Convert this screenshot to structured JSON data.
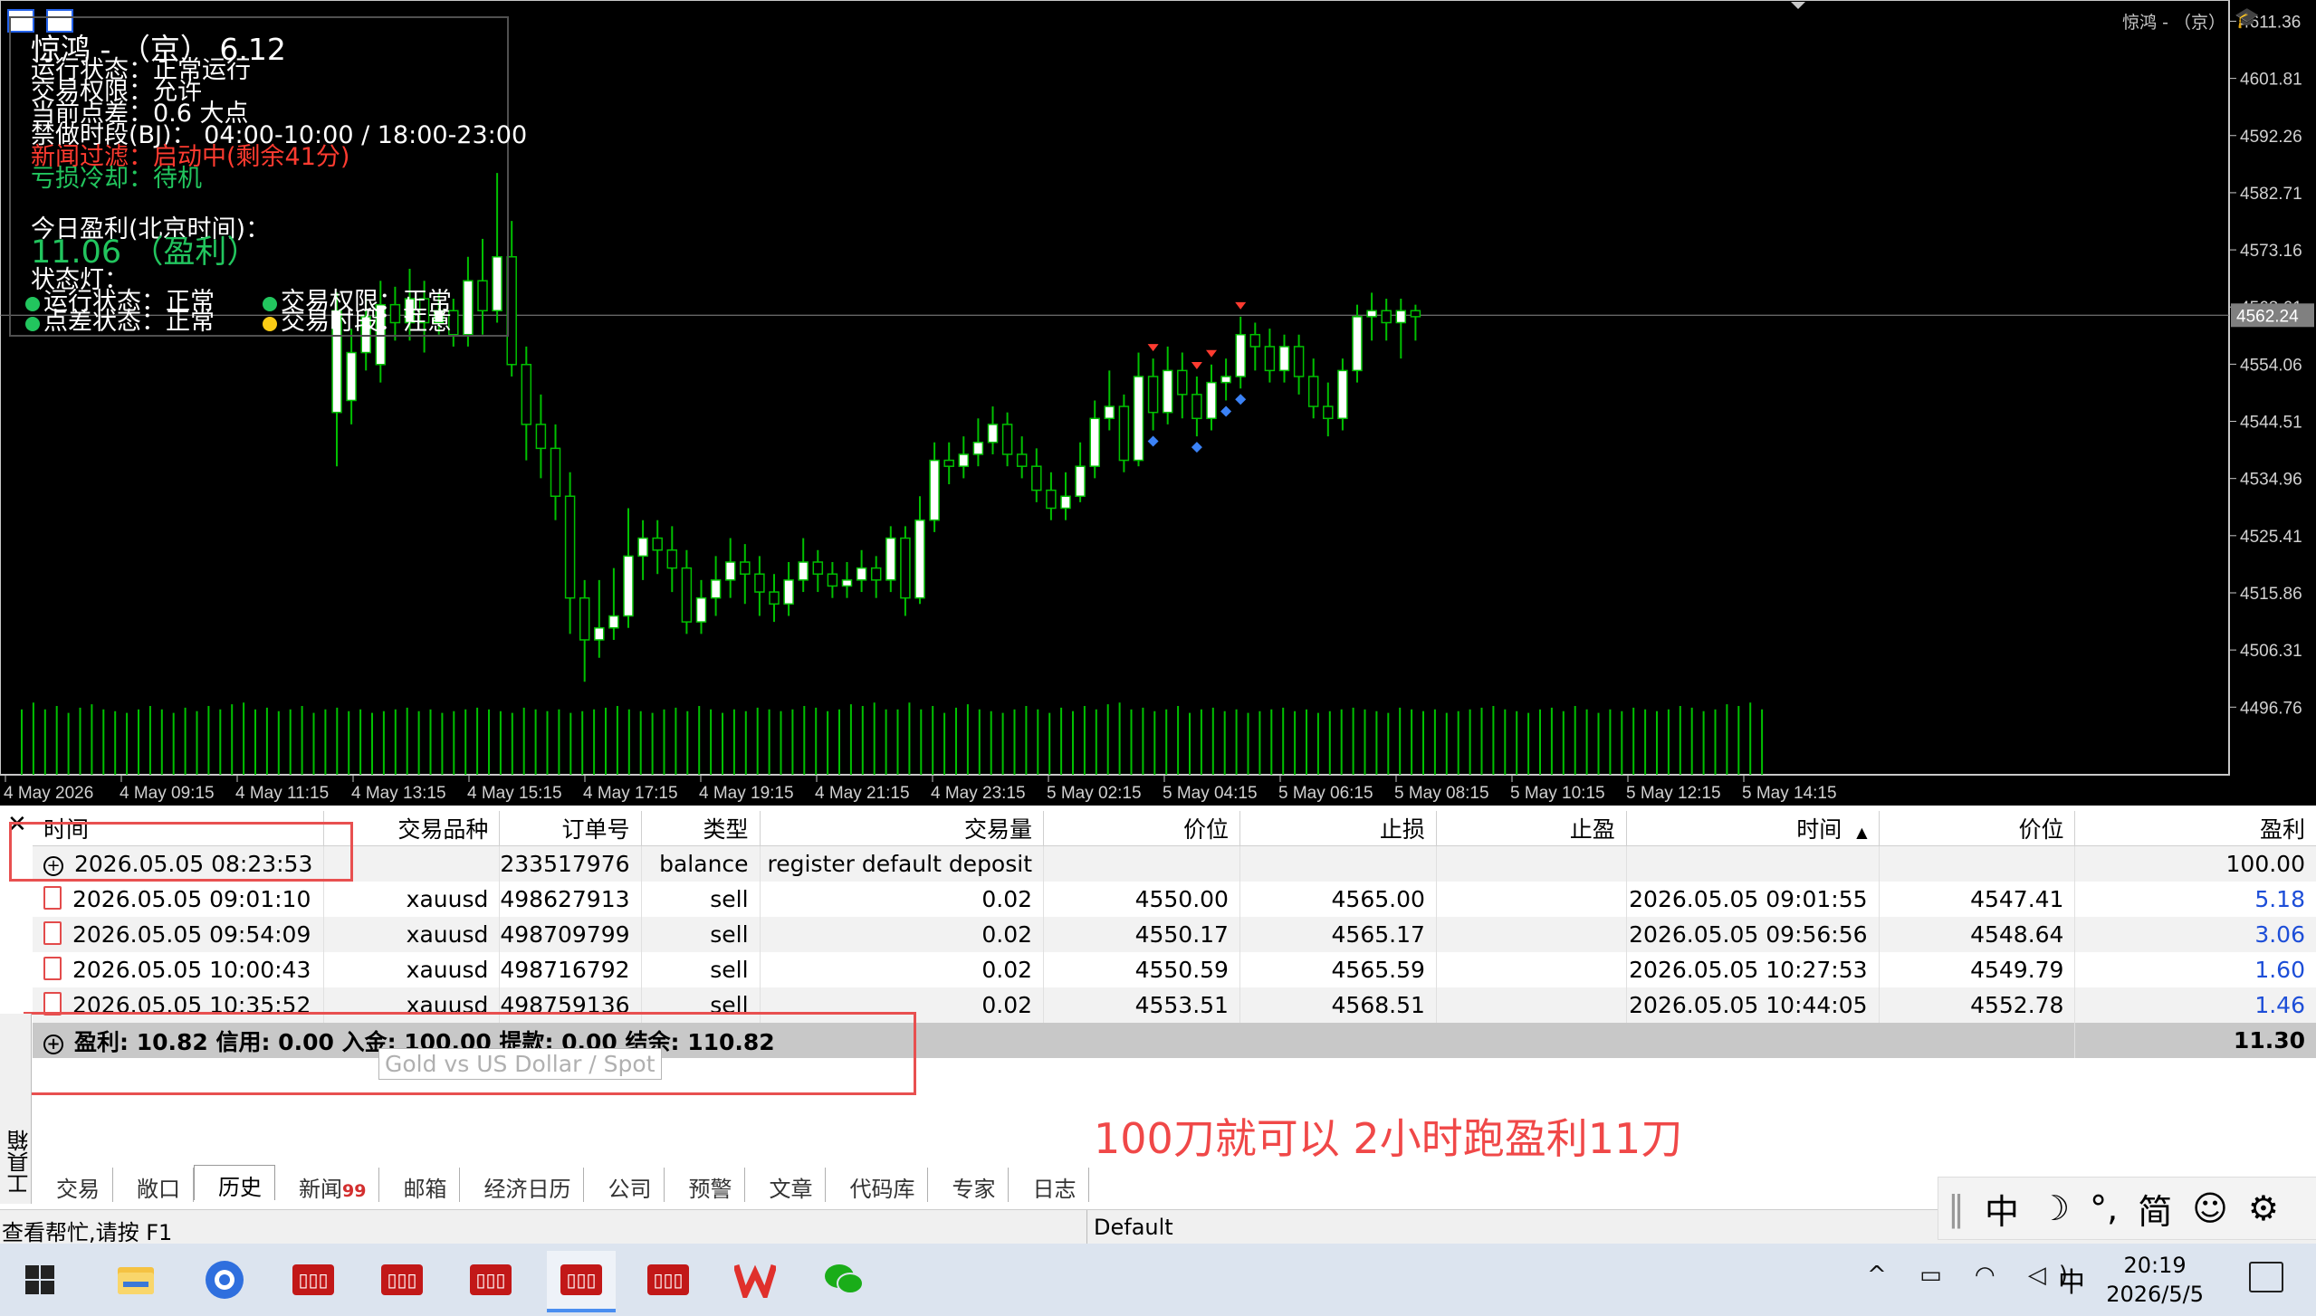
{
  "chart": {
    "symbol_title": "惊鸿 - （京）",
    "overlay": {
      "title": "惊鸿 - （京）",
      "version": "6.12",
      "run_status": "运行状态：正常运行",
      "trade_perm": "交易权限：允许",
      "spread": "当前点差：0.6 大点",
      "forbidden": "禁做时段(BJ)： 04:00-10:00 / 18:00-23:00",
      "news_filter": "新闻过滤：启动中(剩余41分)",
      "loss_cooldown": "亏损冷却：待机",
      "today_label": "今日盈利(北京时间)：",
      "today_value": "11.06",
      "today_state": "（盈利）",
      "lights_label": "状态灯：",
      "light1": "运行状态：正常",
      "light2": "交易权限：正常",
      "light3": "点差状态：正常",
      "light4": "交易时段：注意",
      "light_colors": {
        "ok": "#22c55e",
        "warn": "#facc15"
      }
    },
    "current_price": "4562.24"
  },
  "chart_data": {
    "type": "candlestick",
    "y_ticks": [
      "4611.36",
      "4601.81",
      "4592.26",
      "4582.71",
      "4573.16",
      "4563.61",
      "4554.06",
      "4544.51",
      "4534.96",
      "4525.41",
      "4515.86",
      "4506.31",
      "4496.76"
    ],
    "x_ticks": [
      "4 May 2026",
      "4 May 09:15",
      "4 May 11:15",
      "4 May 13:15",
      "4 May 15:15",
      "4 May 17:15",
      "4 May 19:15",
      "4 May 21:15",
      "4 May 23:15",
      "5 May 02:15",
      "5 May 04:15",
      "5 May 06:15",
      "5 May 08:15",
      "5 May 10:15",
      "5 May 12:15",
      "5 May 14:15"
    ],
    "current_price": 4562.24,
    "colors": {
      "up": "#ffffff",
      "down": "#000000",
      "wick": "#00c000",
      "volume": "#00c000",
      "background": "#000000"
    },
    "candles": [
      {
        "o": 4546,
        "c": 4563,
        "h": 4566,
        "l": 4537
      },
      {
        "o": 4548,
        "c": 4556,
        "h": 4560,
        "l": 4544
      },
      {
        "o": 4556,
        "c": 4562,
        "h": 4566,
        "l": 4553
      },
      {
        "o": 4554,
        "c": 4564,
        "h": 4568,
        "l": 4551
      },
      {
        "o": 4564,
        "c": 4561,
        "h": 4567,
        "l": 4558
      },
      {
        "o": 4561,
        "c": 4565,
        "h": 4570,
        "l": 4558
      },
      {
        "o": 4565,
        "c": 4561,
        "h": 4568,
        "l": 4556
      },
      {
        "o": 4561,
        "c": 4563,
        "h": 4566,
        "l": 4559
      },
      {
        "o": 4563,
        "c": 4559,
        "h": 4565,
        "l": 4557
      },
      {
        "o": 4559,
        "c": 4568,
        "h": 4572,
        "l": 4557
      },
      {
        "o": 4568,
        "c": 4563,
        "h": 4575,
        "l": 4559
      },
      {
        "o": 4563,
        "c": 4572,
        "h": 4586,
        "l": 4561
      },
      {
        "o": 4572,
        "c": 4554,
        "h": 4578,
        "l": 4552
      },
      {
        "o": 4554,
        "c": 4544,
        "h": 4557,
        "l": 4538
      },
      {
        "o": 4544,
        "c": 4540,
        "h": 4549,
        "l": 4535
      },
      {
        "o": 4540,
        "c": 4532,
        "h": 4544,
        "l": 4528
      },
      {
        "o": 4532,
        "c": 4515,
        "h": 4536,
        "l": 4509
      },
      {
        "o": 4515,
        "c": 4508,
        "h": 4518,
        "l": 4501
      },
      {
        "o": 4508,
        "c": 4510,
        "h": 4518,
        "l": 4505
      },
      {
        "o": 4510,
        "c": 4512,
        "h": 4520,
        "l": 4508
      },
      {
        "o": 4512,
        "c": 4522,
        "h": 4530,
        "l": 4510
      },
      {
        "o": 4522,
        "c": 4525,
        "h": 4528,
        "l": 4518
      },
      {
        "o": 4525,
        "c": 4523,
        "h": 4528,
        "l": 4519
      },
      {
        "o": 4523,
        "c": 4520,
        "h": 4527,
        "l": 4516
      },
      {
        "o": 4520,
        "c": 4511,
        "h": 4523,
        "l": 4509
      },
      {
        "o": 4511,
        "c": 4515,
        "h": 4518,
        "l": 4509
      },
      {
        "o": 4515,
        "c": 4518,
        "h": 4522,
        "l": 4512
      },
      {
        "o": 4518,
        "c": 4521,
        "h": 4525,
        "l": 4515
      },
      {
        "o": 4521,
        "c": 4519,
        "h": 4524,
        "l": 4514
      },
      {
        "o": 4519,
        "c": 4516,
        "h": 4522,
        "l": 4512
      },
      {
        "o": 4516,
        "c": 4514,
        "h": 4519,
        "l": 4511
      },
      {
        "o": 4514,
        "c": 4518,
        "h": 4521,
        "l": 4512
      },
      {
        "o": 4518,
        "c": 4521,
        "h": 4525,
        "l": 4516
      },
      {
        "o": 4521,
        "c": 4519,
        "h": 4523,
        "l": 4516
      },
      {
        "o": 4519,
        "c": 4517,
        "h": 4521,
        "l": 4515
      },
      {
        "o": 4517,
        "c": 4518,
        "h": 4521,
        "l": 4515
      },
      {
        "o": 4518,
        "c": 4520,
        "h": 4523,
        "l": 4516
      },
      {
        "o": 4520,
        "c": 4518,
        "h": 4522,
        "l": 4515
      },
      {
        "o": 4518,
        "c": 4525,
        "h": 4527,
        "l": 4516
      },
      {
        "o": 4525,
        "c": 4515,
        "h": 4527,
        "l": 4512
      },
      {
        "o": 4515,
        "c": 4528,
        "h": 4532,
        "l": 4514
      },
      {
        "o": 4528,
        "c": 4538,
        "h": 4541,
        "l": 4526
      },
      {
        "o": 4538,
        "c": 4537,
        "h": 4541,
        "l": 4534
      },
      {
        "o": 4537,
        "c": 4539,
        "h": 4542,
        "l": 4535
      },
      {
        "o": 4539,
        "c": 4541,
        "h": 4545,
        "l": 4537
      },
      {
        "o": 4541,
        "c": 4544,
        "h": 4547,
        "l": 4539
      },
      {
        "o": 4544,
        "c": 4539,
        "h": 4546,
        "l": 4537
      },
      {
        "o": 4539,
        "c": 4537,
        "h": 4542,
        "l": 4535
      },
      {
        "o": 4537,
        "c": 4533,
        "h": 4540,
        "l": 4531
      },
      {
        "o": 4533,
        "c": 4530,
        "h": 4536,
        "l": 4528
      },
      {
        "o": 4530,
        "c": 4532,
        "h": 4536,
        "l": 4528
      },
      {
        "o": 4532,
        "c": 4537,
        "h": 4541,
        "l": 4531
      },
      {
        "o": 4537,
        "c": 4545,
        "h": 4548,
        "l": 4535
      },
      {
        "o": 4545,
        "c": 4547,
        "h": 4553,
        "l": 4543
      },
      {
        "o": 4547,
        "c": 4538,
        "h": 4549,
        "l": 4536
      },
      {
        "o": 4538,
        "c": 4552,
        "h": 4556,
        "l": 4537
      },
      {
        "o": 4552,
        "c": 4546,
        "h": 4555,
        "l": 4543
      },
      {
        "o": 4546,
        "c": 4553,
        "h": 4557,
        "l": 4544
      },
      {
        "o": 4553,
        "c": 4549,
        "h": 4556,
        "l": 4545
      },
      {
        "o": 4549,
        "c": 4545,
        "h": 4552,
        "l": 4542
      },
      {
        "o": 4545,
        "c": 4551,
        "h": 4554,
        "l": 4543
      },
      {
        "o": 4551,
        "c": 4552,
        "h": 4555,
        "l": 4548
      },
      {
        "o": 4552,
        "c": 4559,
        "h": 4562,
        "l": 4550
      },
      {
        "o": 4559,
        "c": 4557,
        "h": 4561,
        "l": 4553
      },
      {
        "o": 4557,
        "c": 4553,
        "h": 4560,
        "l": 4551
      },
      {
        "o": 4553,
        "c": 4557,
        "h": 4559,
        "l": 4551
      },
      {
        "o": 4557,
        "c": 4552,
        "h": 4559,
        "l": 4549
      },
      {
        "o": 4552,
        "c": 4547,
        "h": 4555,
        "l": 4545
      },
      {
        "o": 4547,
        "c": 4545,
        "h": 4551,
        "l": 4542
      },
      {
        "o": 4545,
        "c": 4553,
        "h": 4555,
        "l": 4543
      },
      {
        "o": 4553,
        "c": 4562,
        "h": 4564,
        "l": 4551
      },
      {
        "o": 4562,
        "c": 4563,
        "h": 4566,
        "l": 4558
      },
      {
        "o": 4563,
        "c": 4561,
        "h": 4565,
        "l": 4558
      },
      {
        "o": 4561,
        "c": 4563,
        "h": 4565,
        "l": 4555
      },
      {
        "o": 4563,
        "c": 4562,
        "h": 4564,
        "l": 4558
      }
    ],
    "volumes": [
      38,
      42,
      38,
      40,
      36,
      39,
      41,
      38,
      37,
      36,
      38,
      40,
      38,
      36,
      39,
      37,
      40,
      38,
      41,
      42,
      38,
      39,
      37,
      38,
      40,
      36,
      38,
      39,
      37,
      38,
      36,
      37,
      38,
      39,
      37,
      38,
      36,
      37,
      38,
      39,
      38,
      37,
      36,
      39,
      38,
      37,
      38,
      36,
      37,
      38,
      39,
      40,
      38,
      37,
      36,
      38,
      39,
      37,
      40,
      38,
      36,
      38,
      37,
      39,
      38,
      37,
      38,
      40,
      39,
      37,
      38,
      41,
      40,
      42,
      38
    ],
    "trade_markers": [
      {
        "candle": 56,
        "kind": "sell_open"
      },
      {
        "candle": 56,
        "kind": "close"
      },
      {
        "candle": 59,
        "kind": "sell_open"
      },
      {
        "candle": 59,
        "kind": "close"
      },
      {
        "candle": 60,
        "kind": "sell_open"
      },
      {
        "candle": 61,
        "kind": "close"
      },
      {
        "candle": 62,
        "kind": "sell_open"
      },
      {
        "candle": 62,
        "kind": "close"
      }
    ]
  },
  "terminal": {
    "columns": [
      "时间",
      "交易品种",
      "订单号",
      "类型",
      "交易量",
      "价位",
      "止损",
      "止盈",
      "时间",
      "价位",
      "盈利"
    ],
    "sort_arrow": "▲",
    "rows": [
      {
        "time": "2026.05.05 08:23:53",
        "symbol": "",
        "order": "233517976",
        "type": "balance",
        "volume": "register default deposit",
        "price": "",
        "sl": "",
        "tp": "",
        "time2": "",
        "price2": "",
        "profit": "100.00",
        "icon": "plus"
      },
      {
        "time": "2026.05.05 09:01:10",
        "symbol": "xauusd",
        "order": "498627913",
        "type": "sell",
        "volume": "0.02",
        "price": "4550.00",
        "sl": "4565.00",
        "tp": "",
        "time2": "2026.05.05 09:01:55",
        "price2": "4547.41",
        "profit": "5.18",
        "icon": "doc"
      },
      {
        "time": "2026.05.05 09:54:09",
        "symbol": "xauusd",
        "order": "498709799",
        "type": "sell",
        "volume": "0.02",
        "price": "4550.17",
        "sl": "4565.17",
        "tp": "",
        "time2": "2026.05.05 09:56:56",
        "price2": "4548.64",
        "profit": "3.06",
        "icon": "doc"
      },
      {
        "time": "2026.05.05 10:00:43",
        "symbol": "xauusd",
        "order": "498716792",
        "type": "sell",
        "volume": "0.02",
        "price": "4550.59",
        "sl": "4565.59",
        "tp": "",
        "time2": "2026.05.05 10:27:53",
        "price2": "4549.79",
        "profit": "1.60",
        "icon": "doc"
      },
      {
        "time": "2026.05.05 10:35:52",
        "symbol": "xauusd",
        "order": "498759136",
        "type": "sell",
        "volume": "0.02",
        "price": "4553.51",
        "sl": "4568.51",
        "tp": "",
        "time2": "2026.05.05 10:44:05",
        "price2": "4552.78",
        "profit": "1.46",
        "icon": "doc"
      }
    ],
    "summary": {
      "text": "盈利: 10.82  信用: 0.00  入金: 100.00  提款: 0.00  结余: 110.82",
      "total": "11.30"
    },
    "tooltip": "Gold vs US Dollar / Spot",
    "caption": "100刀就可以 2小时跑盈利11刀",
    "side_label": "工具箱",
    "tabs": [
      {
        "label": "交易",
        "badge": ""
      },
      {
        "label": "敞口",
        "badge": ""
      },
      {
        "label": "历史",
        "badge": "",
        "active": true
      },
      {
        "label": "新闻",
        "badge": "99"
      },
      {
        "label": "邮箱",
        "badge": ""
      },
      {
        "label": "经济日历",
        "badge": ""
      },
      {
        "label": "公司",
        "badge": ""
      },
      {
        "label": "预警",
        "badge": ""
      },
      {
        "label": "文章",
        "badge": ""
      },
      {
        "label": "代码库",
        "badge": ""
      },
      {
        "label": "专家",
        "badge": ""
      },
      {
        "label": "日志",
        "badge": ""
      }
    ]
  },
  "statusbar": {
    "help": "查看帮忙,请按 F1",
    "profile": "Default"
  },
  "ime": {
    "lang": "中",
    "moon": "☽",
    "punct": "°,",
    "simp": "简",
    "emoji": "☺",
    "gear": "⚙"
  },
  "taskbar": {
    "time": "20:19",
    "date": "2026/5/5",
    "ime_indicator": "中",
    "tray": "^ ▭ ◠ ◁)"
  }
}
